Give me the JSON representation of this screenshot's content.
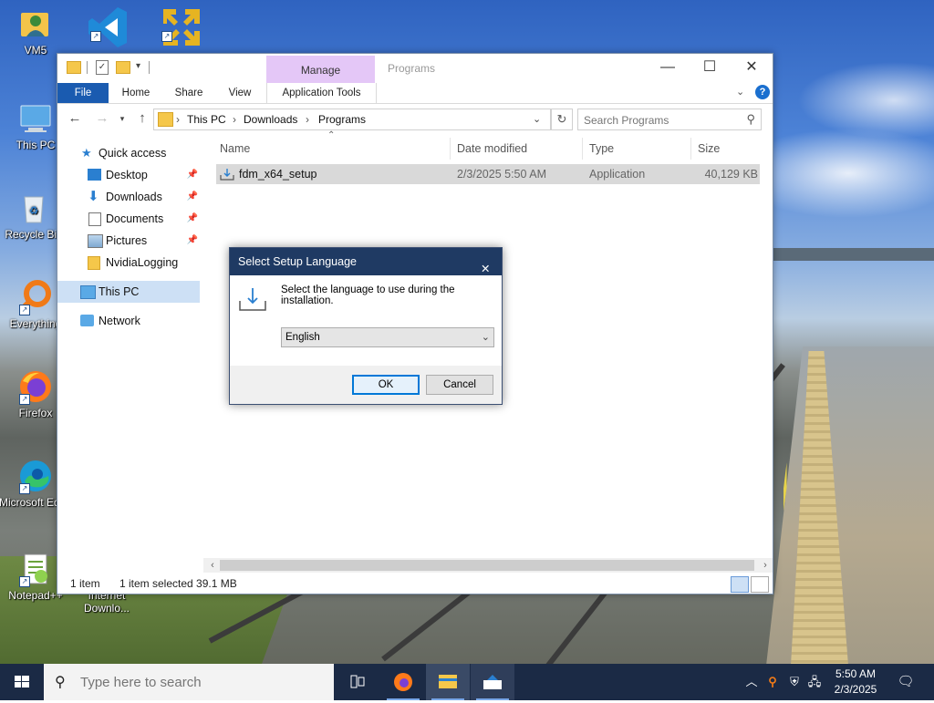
{
  "desktop": {
    "icons": [
      {
        "label": "VM5"
      },
      {
        "label": "This PC"
      },
      {
        "label": "Recycle Bin"
      },
      {
        "label": "Everything"
      },
      {
        "label": "Firefox"
      },
      {
        "label": "Microsoft Edge"
      },
      {
        "label": "Notepad++"
      },
      {
        "label": "Internet Downlo..."
      }
    ]
  },
  "explorer": {
    "title": "Programs",
    "manage_label": "Manage",
    "tabs": [
      "File",
      "Home",
      "Share",
      "View",
      "Application Tools"
    ],
    "breadcrumb": [
      "This PC",
      "Downloads",
      "Programs"
    ],
    "search_placeholder": "Search Programs",
    "nav": {
      "quick_access": "Quick access",
      "items": [
        "Desktop",
        "Downloads",
        "Documents",
        "Pictures",
        "NvidiaLogging"
      ],
      "this_pc": "This PC",
      "network": "Network"
    },
    "columns": {
      "name": "Name",
      "date": "Date modified",
      "type": "Type",
      "size": "Size"
    },
    "files": [
      {
        "name": "fdm_x64_setup",
        "date": "2/3/2025 5:50 AM",
        "type": "Application",
        "size": "40,129 KB"
      }
    ],
    "status": {
      "count": "1 item",
      "selected": "1 item selected  39.1 MB"
    }
  },
  "dialog": {
    "title": "Select Setup Language",
    "message": "Select the language to use during the installation.",
    "language": "English",
    "ok": "OK",
    "cancel": "Cancel"
  },
  "taskbar": {
    "search_placeholder": "Type here to search",
    "time": "5:50 AM",
    "date": "2/3/2025"
  },
  "colors": {
    "accent": "#1a5bb0",
    "manage_tab": "#e4c7f7",
    "dialog_title": "#1f3a63",
    "taskbar": "#1b2a45",
    "selection": "#cde0f5"
  }
}
